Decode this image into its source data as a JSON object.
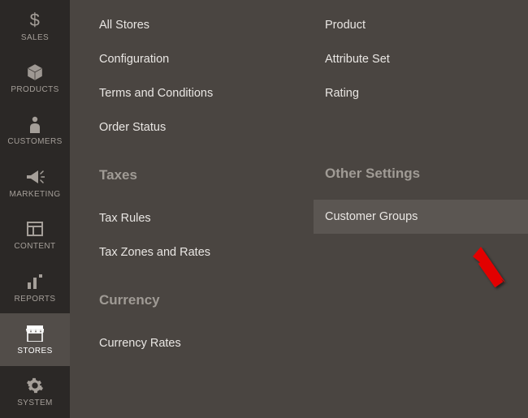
{
  "sidebar": {
    "items": [
      {
        "label": "SALES",
        "icon": "$"
      },
      {
        "label": "PRODUCTS",
        "icon": "cube"
      },
      {
        "label": "CUSTOMERS",
        "icon": "person"
      },
      {
        "label": "MARKETING",
        "icon": "megaphone"
      },
      {
        "label": "CONTENT",
        "icon": "layout"
      },
      {
        "label": "REPORTS",
        "icon": "bars"
      },
      {
        "label": "STORES",
        "icon": "store"
      },
      {
        "label": "SYSTEM",
        "icon": "gear"
      }
    ]
  },
  "flyout": {
    "left_column": {
      "top_items": [
        "All Stores",
        "Configuration",
        "Terms and Conditions",
        "Order Status"
      ],
      "sections": [
        {
          "heading": "Taxes",
          "items": [
            "Tax Rules",
            "Tax Zones and Rates"
          ]
        },
        {
          "heading": "Currency",
          "items": [
            "Currency Rates"
          ]
        }
      ]
    },
    "right_column": {
      "top_items": [
        "Product",
        "Attribute Set",
        "Rating"
      ],
      "sections": [
        {
          "heading": "Other Settings",
          "items": [
            "Customer Groups"
          ]
        }
      ]
    },
    "highlighted_item": "Customer Groups"
  }
}
